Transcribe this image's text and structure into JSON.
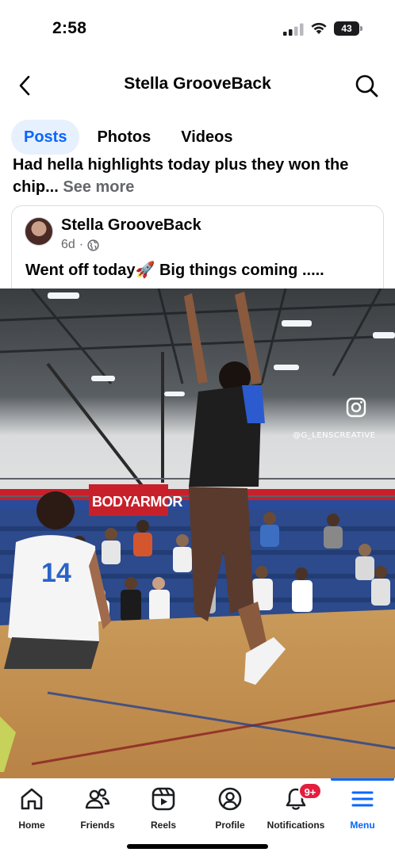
{
  "status": {
    "time": "2:58",
    "battery_level": "43"
  },
  "header": {
    "title": "Stella GrooveBack",
    "icons": {
      "back": "chevron-left-icon",
      "search": "search-icon"
    }
  },
  "tabs": [
    {
      "label": "Posts",
      "active": true
    },
    {
      "label": "Photos",
      "active": false
    },
    {
      "label": "Videos",
      "active": false
    }
  ],
  "previous_post": {
    "text": "Had hella highlights today plus they won the chip...",
    "see_more": "See more"
  },
  "post": {
    "author": "Stella GrooveBack",
    "time": "6d",
    "separator": "·",
    "privacy_icon": "globe-icon",
    "text": "Went off today🚀 Big things coming .....",
    "media": {
      "watermark": "@G_LENSCREATIVE",
      "banner_text": "BODYARMOR",
      "jersey_number": "14"
    }
  },
  "bottom_nav": {
    "items": [
      {
        "label": "Home",
        "icon": "home-icon"
      },
      {
        "label": "Friends",
        "icon": "friends-icon"
      },
      {
        "label": "Reels",
        "icon": "reels-icon"
      },
      {
        "label": "Profile",
        "icon": "profile-icon"
      },
      {
        "label": "Notifications",
        "icon": "bell-icon",
        "badge": "9+"
      },
      {
        "label": "Menu",
        "icon": "menu-icon",
        "active": true
      }
    ]
  },
  "colors": {
    "accent": "#0866ff",
    "tab_active_bg": "#e7f0fd",
    "badge": "#e41e3f",
    "secondary_text": "#65676b"
  }
}
